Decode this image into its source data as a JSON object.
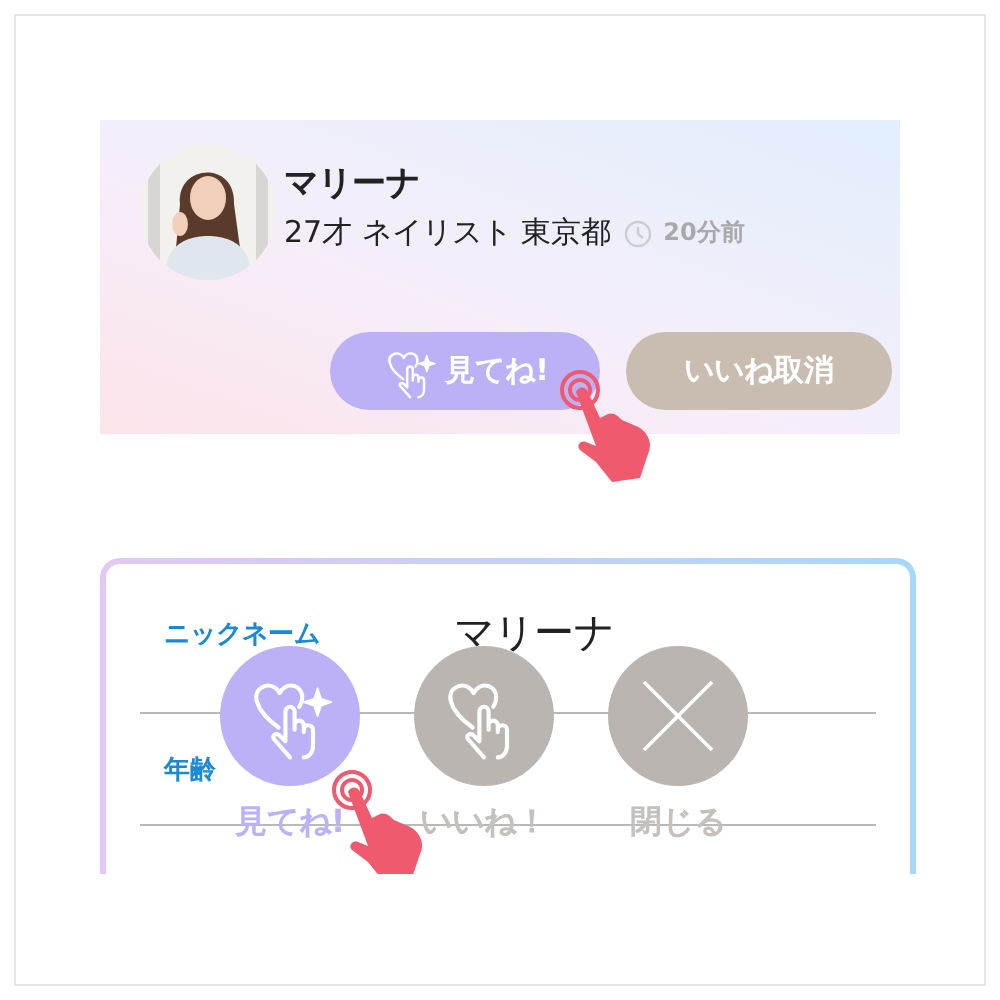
{
  "profile_card": {
    "name": "マリーナ",
    "details": "27才 ネイリスト 東京都",
    "time": "20分前",
    "buttons": [
      {
        "label": "見てね!",
        "kind": "look"
      },
      {
        "label": "いいね取消",
        "kind": "cancel"
      }
    ]
  },
  "detail_card": {
    "rows": [
      {
        "label": "ニックネーム",
        "value": "マリーナ"
      },
      {
        "label": "年齢"
      }
    ]
  },
  "actions": [
    {
      "label": "見てね!",
      "kind": "look"
    },
    {
      "label": "いいね！",
      "kind": "like"
    },
    {
      "label": "閉じる",
      "kind": "close"
    }
  ]
}
